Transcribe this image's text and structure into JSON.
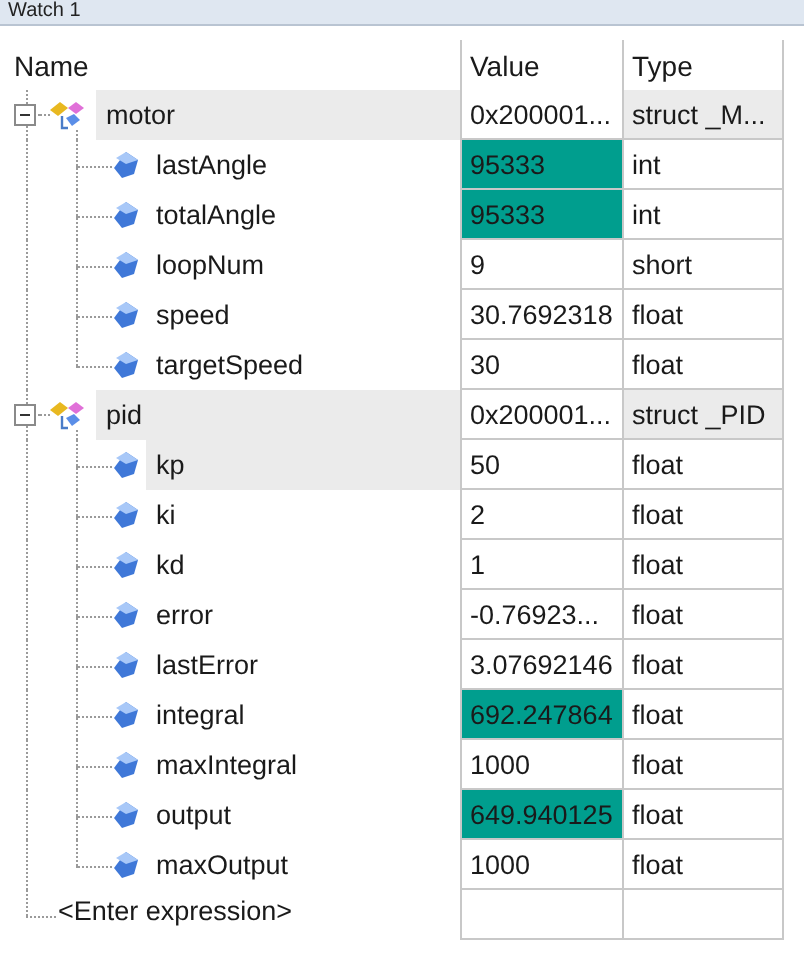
{
  "window": {
    "title": "Watch 1"
  },
  "columns": [
    "Name",
    "Value",
    "Type"
  ],
  "items": [
    {
      "kind": "struct",
      "name": "motor",
      "value": "0x200001...",
      "type": "struct _M...",
      "expanded": true,
      "selected": false,
      "changed": false,
      "children": [
        {
          "kind": "member",
          "name": "lastAngle",
          "value": "95333",
          "type": "int",
          "selected": false,
          "changed": true
        },
        {
          "kind": "member",
          "name": "totalAngle",
          "value": "95333",
          "type": "int",
          "selected": false,
          "changed": true
        },
        {
          "kind": "member",
          "name": "loopNum",
          "value": "9",
          "type": "short",
          "selected": false,
          "changed": false
        },
        {
          "kind": "member",
          "name": "speed",
          "value": "30.7692318",
          "type": "float",
          "selected": false,
          "changed": false
        },
        {
          "kind": "member",
          "name": "targetSpeed",
          "value": "30",
          "type": "float",
          "selected": false,
          "changed": false
        }
      ]
    },
    {
      "kind": "struct",
      "name": "pid",
      "value": "0x200001...",
      "type": "struct _PID",
      "expanded": true,
      "selected": false,
      "changed": false,
      "children": [
        {
          "kind": "member",
          "name": "kp",
          "value": "50",
          "type": "float",
          "selected": true,
          "changed": false
        },
        {
          "kind": "member",
          "name": "ki",
          "value": "2",
          "type": "float",
          "selected": false,
          "changed": false
        },
        {
          "kind": "member",
          "name": "kd",
          "value": "1",
          "type": "float",
          "selected": false,
          "changed": false
        },
        {
          "kind": "member",
          "name": "error",
          "value": "-0.76923...",
          "type": "float",
          "selected": false,
          "changed": false
        },
        {
          "kind": "member",
          "name": "lastError",
          "value": "3.07692146",
          "type": "float",
          "selected": false,
          "changed": false
        },
        {
          "kind": "member",
          "name": "integral",
          "value": "692.247864",
          "type": "float",
          "selected": false,
          "changed": true
        },
        {
          "kind": "member",
          "name": "maxIntegral",
          "value": "1000",
          "type": "float",
          "selected": false,
          "changed": false
        },
        {
          "kind": "member",
          "name": "output",
          "value": "649.940125",
          "type": "float",
          "selected": false,
          "changed": true
        },
        {
          "kind": "member",
          "name": "maxOutput",
          "value": "1000",
          "type": "float",
          "selected": false,
          "changed": false
        }
      ]
    }
  ],
  "new_expression_prompt": "<Enter expression>"
}
